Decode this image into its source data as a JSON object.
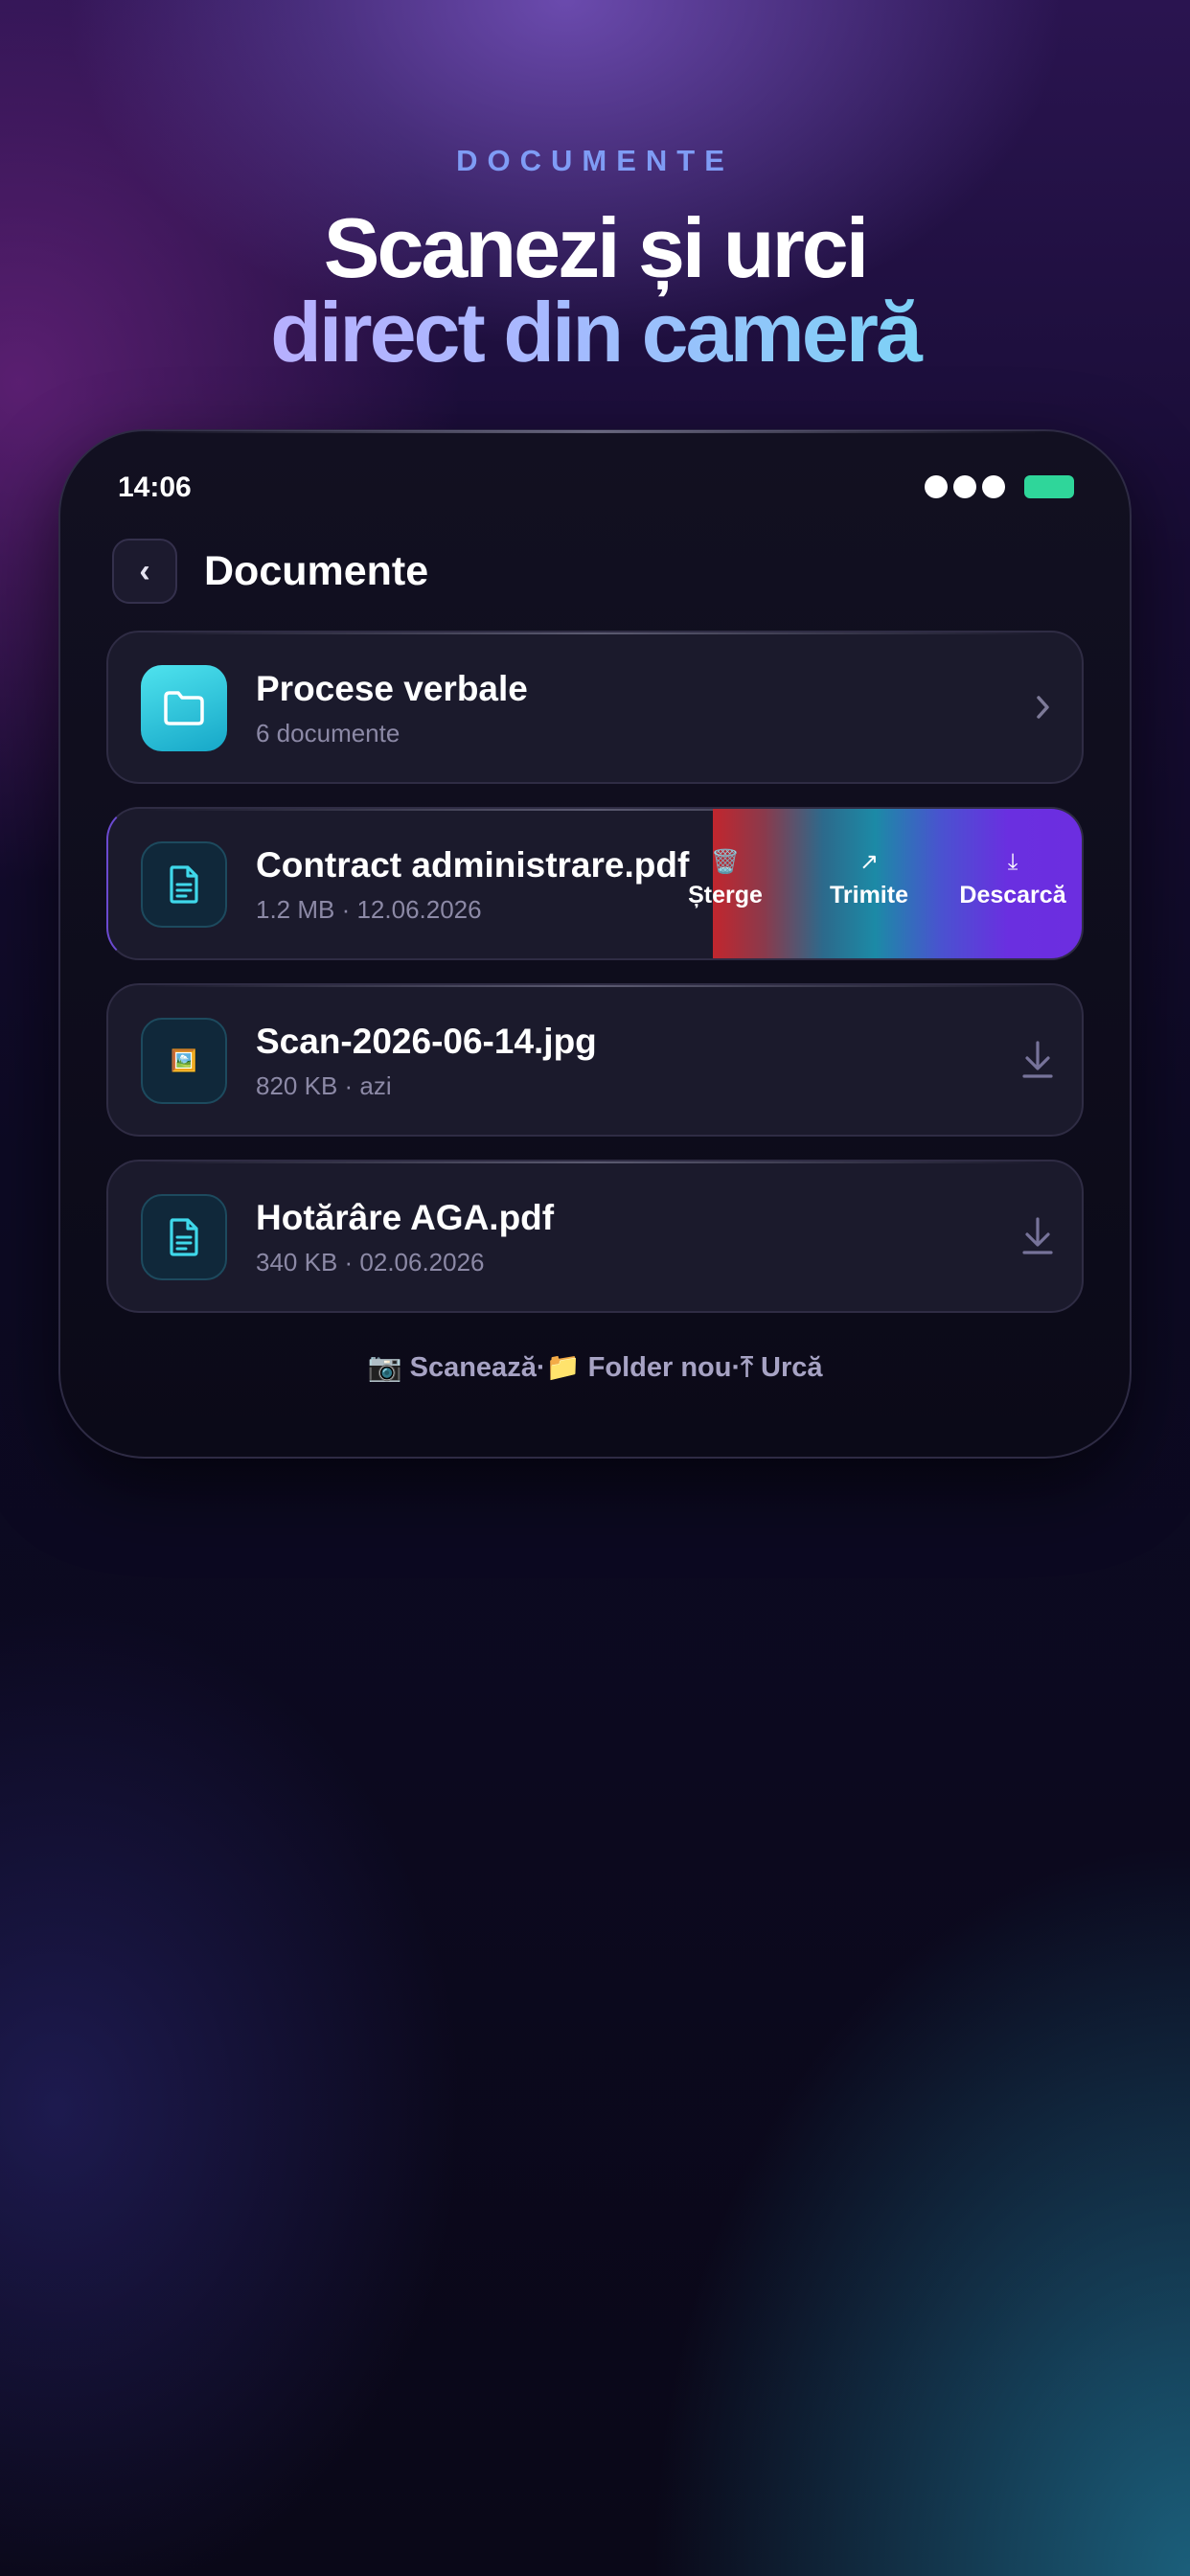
{
  "header": {
    "eyebrow": "DOCUMENTE",
    "title_line1": "Scanezi și urci",
    "title_line2": "direct din cameră"
  },
  "status_bar": {
    "time": "14:06"
  },
  "nav": {
    "back_label": "‹",
    "title": "Documente"
  },
  "items": [
    {
      "title": "Procese verbale",
      "subtitle": "6 documente",
      "icon": "folder-icon"
    },
    {
      "title": "Contract administrare.pdf",
      "subtitle": "1.2 MB · 12.06.2026",
      "icon": "document-icon",
      "swipe_actions": [
        {
          "icon": "🗑️",
          "label": "Șterge",
          "color": "#c0262e"
        },
        {
          "icon": "↗",
          "label": "Trimite",
          "color": "#1c8aa6"
        },
        {
          "icon": "⤓",
          "label": "Descarcă",
          "color": "#6c2ee0"
        }
      ]
    },
    {
      "title": "Scan-2026-06-14.jpg",
      "subtitle": "820 KB · azi",
      "icon": "🖼️"
    },
    {
      "title": "Hotărâre AGA.pdf",
      "subtitle": "340 KB · 02.06.2026",
      "icon": "document-icon"
    }
  ],
  "footer": {
    "scan": "📷 Scanează",
    "sep1": " · ",
    "new_folder": "📁 Folder nou",
    "sep2": " · ",
    "upload": "⤒ Urcă"
  },
  "colors": {
    "accent_cyan": "#3fd8ea",
    "accent_purple": "#6c2ee0",
    "danger": "#c0262e",
    "battery": "#2fd69a"
  }
}
